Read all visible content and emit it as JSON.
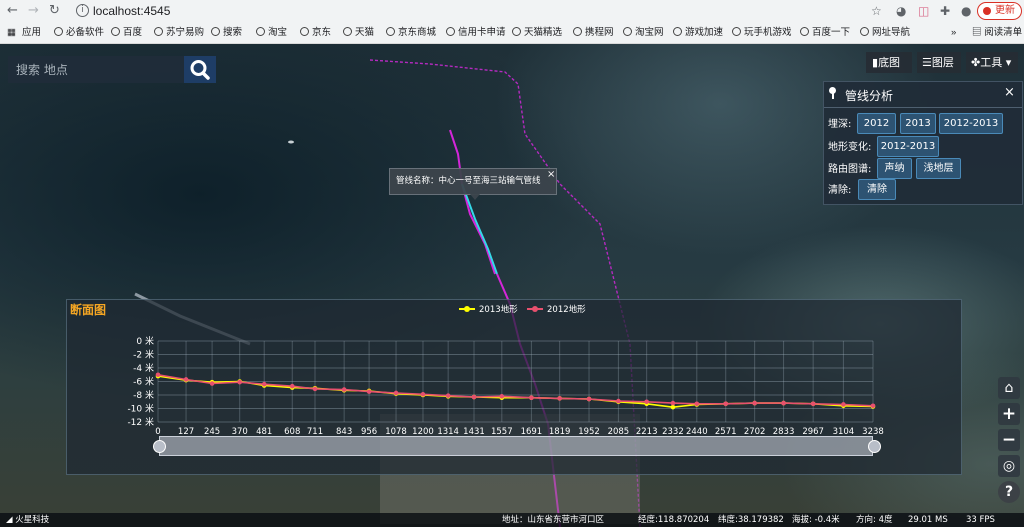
{
  "browser": {
    "url": "localhost:4545",
    "update_label": "更新",
    "bookmarks": [
      "应用",
      "必备软件",
      "百度",
      "苏宁易购",
      "搜索",
      "淘宝",
      "京东",
      "天猫",
      "京东商城",
      "信用卡申请",
      "天猫精选",
      "携程网",
      "淘宝网",
      "游戏加速",
      "玩手机游戏",
      "百度一下",
      "网址导航"
    ],
    "more_label": "»",
    "reading_list_label": "阅读清单"
  },
  "search": {
    "placeholder": "搜索 地点"
  },
  "toolbar": {
    "basemap_label": "底图",
    "layers_label": "图层",
    "tools_label": "工具"
  },
  "panel": {
    "title": "管线分析",
    "burial_label": "埋深:",
    "burial_buttons": [
      "2012",
      "2013",
      "2012-2013"
    ],
    "terrain_label": "地形变化:",
    "terrain_buttons": [
      "2012-2013"
    ],
    "route_label": "路由图谱:",
    "route_buttons": [
      "声纳",
      "浅地层"
    ],
    "clear_label": "清除:",
    "clear_button": "清除"
  },
  "tooltip": {
    "text": "管线名称：中心一号至海三站输气管线",
    "close": "×"
  },
  "profile": {
    "title": "断面图"
  },
  "chart_data": {
    "type": "line",
    "title": "断面图",
    "x": [
      0,
      127,
      245,
      370,
      481,
      608,
      711,
      843,
      956,
      1078,
      1200,
      1314,
      1431,
      1557,
      1691,
      1819,
      1952,
      2085,
      2213,
      2332,
      2440,
      2571,
      2702,
      2833,
      2967,
      3104,
      3238
    ],
    "xlim": [
      0,
      3238
    ],
    "ylim": [
      -12,
      0
    ],
    "yticks": [
      "0 米",
      "-2 米",
      "-4 米",
      "-6 米",
      "-8 米",
      "-10 米",
      "-12 米"
    ],
    "grid": true,
    "legend_position": "top-center",
    "series": [
      {
        "name": "2013地形",
        "color": "#ffff00",
        "values": [
          -5.2,
          -5.8,
          -6.1,
          -6.0,
          -6.6,
          -6.9,
          -7.0,
          -7.3,
          -7.4,
          -7.8,
          -8.0,
          -8.2,
          -8.3,
          -8.4,
          -8.4,
          -8.5,
          -8.6,
          -9.0,
          -9.3,
          -9.8,
          -9.4,
          -9.3,
          -9.2,
          -9.2,
          -9.3,
          -9.6,
          -9.7
        ]
      },
      {
        "name": "2012地形",
        "color": "#e8506e",
        "values": [
          -5.0,
          -5.7,
          -6.3,
          -6.1,
          -6.4,
          -6.7,
          -7.1,
          -7.2,
          -7.5,
          -7.7,
          -7.9,
          -8.1,
          -8.3,
          -8.2,
          -8.4,
          -8.5,
          -8.6,
          -8.9,
          -9.0,
          -9.2,
          -9.3,
          -9.3,
          -9.2,
          -9.2,
          -9.3,
          -9.4,
          -9.6
        ]
      }
    ]
  },
  "status": {
    "brand": "火星科技",
    "address": "地址：山东省东营市河口区",
    "lon": "经度:118.870204",
    "lat": "纬度:38.179382",
    "alt": "海拔: -0.4米",
    "heading": "方向: 4度",
    "ms": "29.01 MS",
    "fps": "33 FPS"
  },
  "colors": {
    "accent": "#1e3d66",
    "pipeline_magenta": "#c020c8",
    "pipeline_cyan": "#35d8e8",
    "title_orange": "#f5a623"
  },
  "icons": [
    "back-icon",
    "forward-icon",
    "reload-icon",
    "info-icon",
    "star-icon",
    "extension-icon",
    "profile-icon",
    "map-icon",
    "layers-icon",
    "tools-icon",
    "pin-icon",
    "close-icon",
    "home-icon",
    "zoom-in-icon",
    "zoom-out-icon",
    "globe-icon",
    "help-icon",
    "search-icon"
  ]
}
